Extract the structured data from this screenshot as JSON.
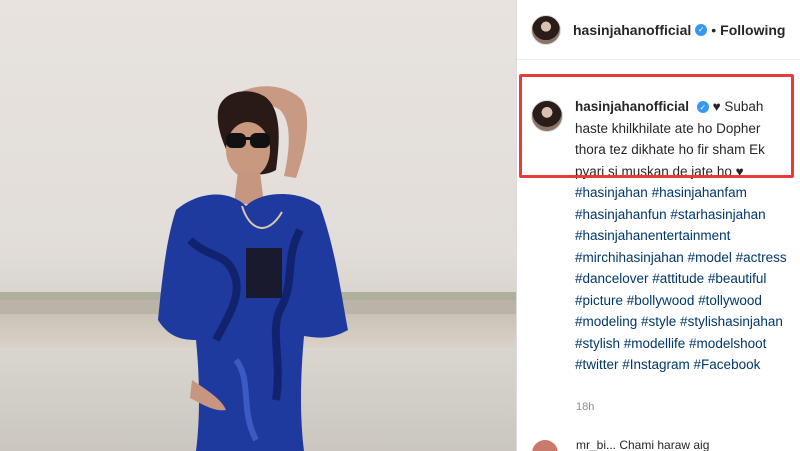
{
  "post": {
    "username": "hasinjahanofficial",
    "follow_status": "Following",
    "separator": "•",
    "verified_icon": "verified-badge-icon"
  },
  "caption": {
    "username": "hasinjahanofficial",
    "text": "Subah haste khilkhilate ate ho Dopher thora tez dikhate ho fir sham Ek pyari si muskan de jate ho",
    "heart": "♥",
    "hashtags": "#hasinjahan #hasinjahanfam #hasinjahanfun #starhasinjahan #hasinjahanentertainment #mirchihasinjahan #model #actress #dancelover #attitude #beautiful #picture #bollywood #tollywood #modeling #style #stylishasinjahan #stylish #modellife #modelshoot #twitter #Instagram #Facebook"
  },
  "meta": {
    "timestamp": "18h"
  },
  "next_comment": {
    "text": "mr_bi...  Chami haraw aig"
  },
  "colors": {
    "highlight": "#ea3b3b",
    "hashtag": "#00376b",
    "verified": "#3897f0",
    "dress": "#1f3a9e"
  }
}
